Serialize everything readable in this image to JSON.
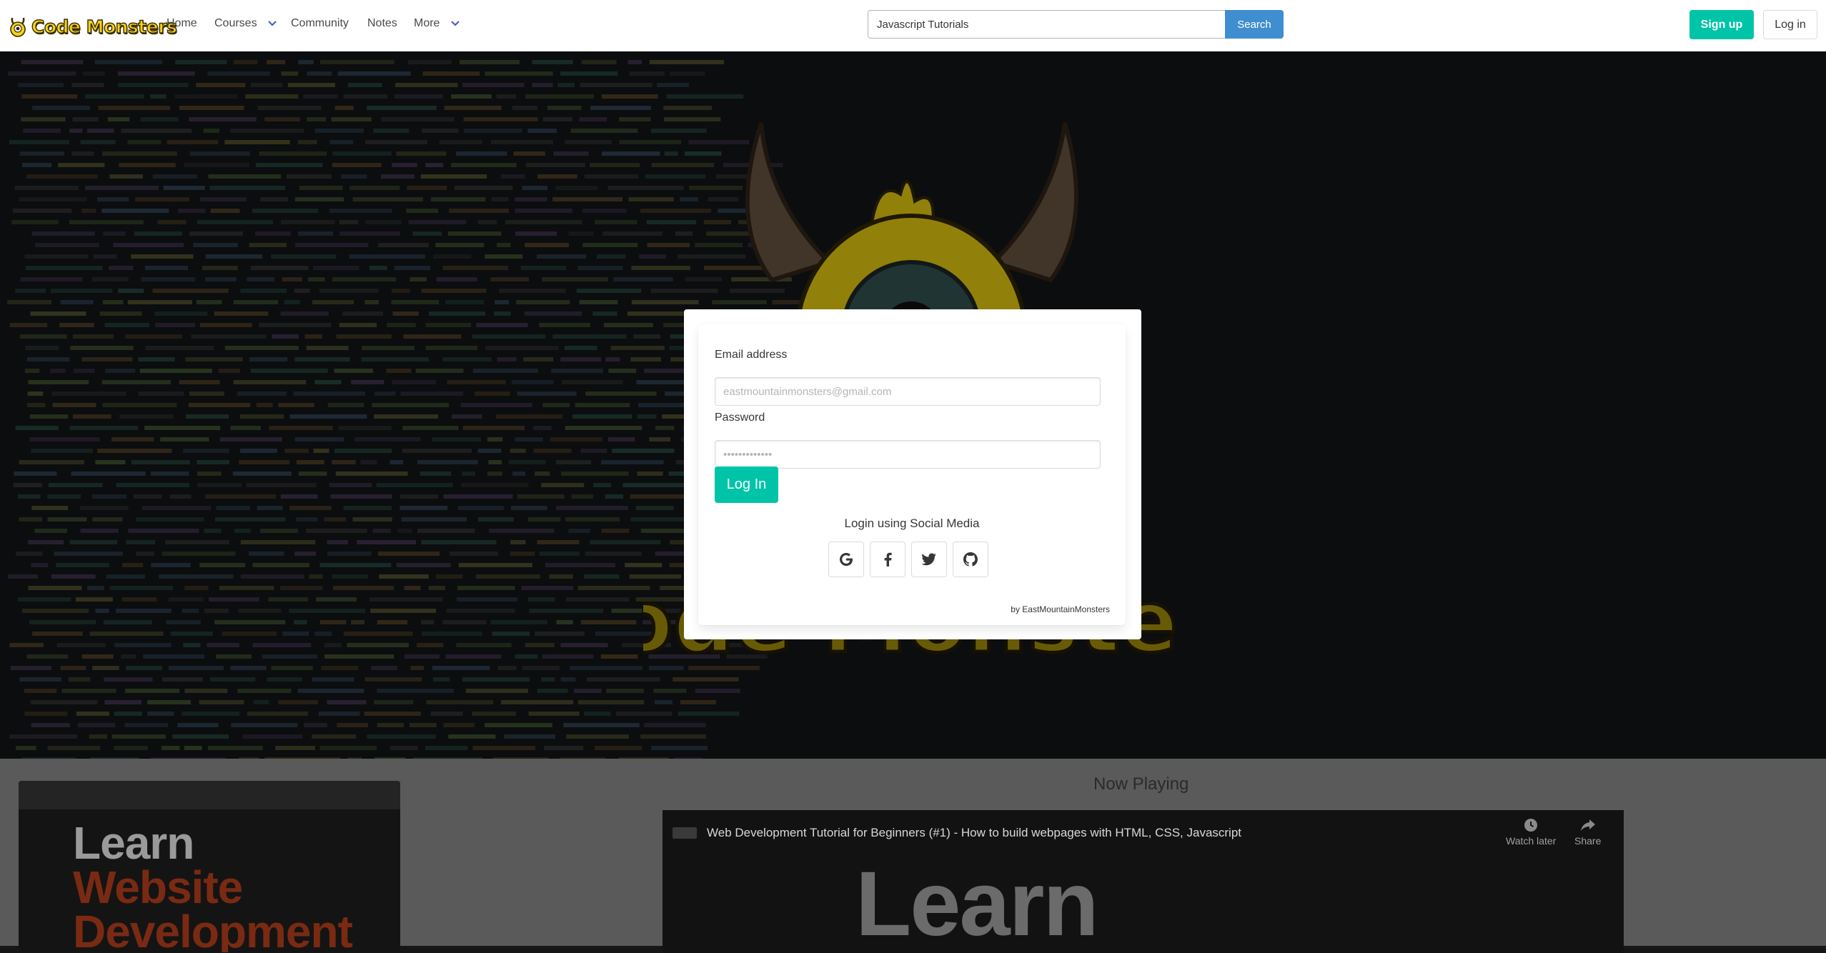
{
  "brand": {
    "name": "Code Monsters",
    "color": "#f5d21b"
  },
  "nav": {
    "home": "Home",
    "courses": "Courses",
    "community": "Community",
    "notes": "Notes",
    "more": "More"
  },
  "search": {
    "value": "Javascript Tutorials",
    "button": "Search"
  },
  "auth": {
    "signup": "Sign up",
    "login": "Log in"
  },
  "login_form": {
    "email_label": "Email address",
    "email_placeholder": "eastmountainmonsters@gmail.com",
    "password_label": "Password",
    "password_placeholder": "•••••••••••••",
    "submit": "Log In",
    "social_title": "Login using Social Media",
    "social": [
      "google-icon",
      "facebook-icon",
      "twitter-icon",
      "github-icon"
    ],
    "credit": "by EastMountainMonsters"
  },
  "hero_logo_text": "Code Monsters",
  "bottom": {
    "thumbnail_lines": [
      "Learn",
      "Website",
      "Development"
    ],
    "now_playing": "Now Playing",
    "video": {
      "title": "Web Development Tutorial for Beginners (#1) - How to build webpages with HTML, CSS, Javascript",
      "watch_later": "Watch later",
      "share": "Share",
      "big_text": "Learn"
    }
  },
  "colors": {
    "primary": "#00c4a7",
    "info": "#3e8ed0"
  }
}
